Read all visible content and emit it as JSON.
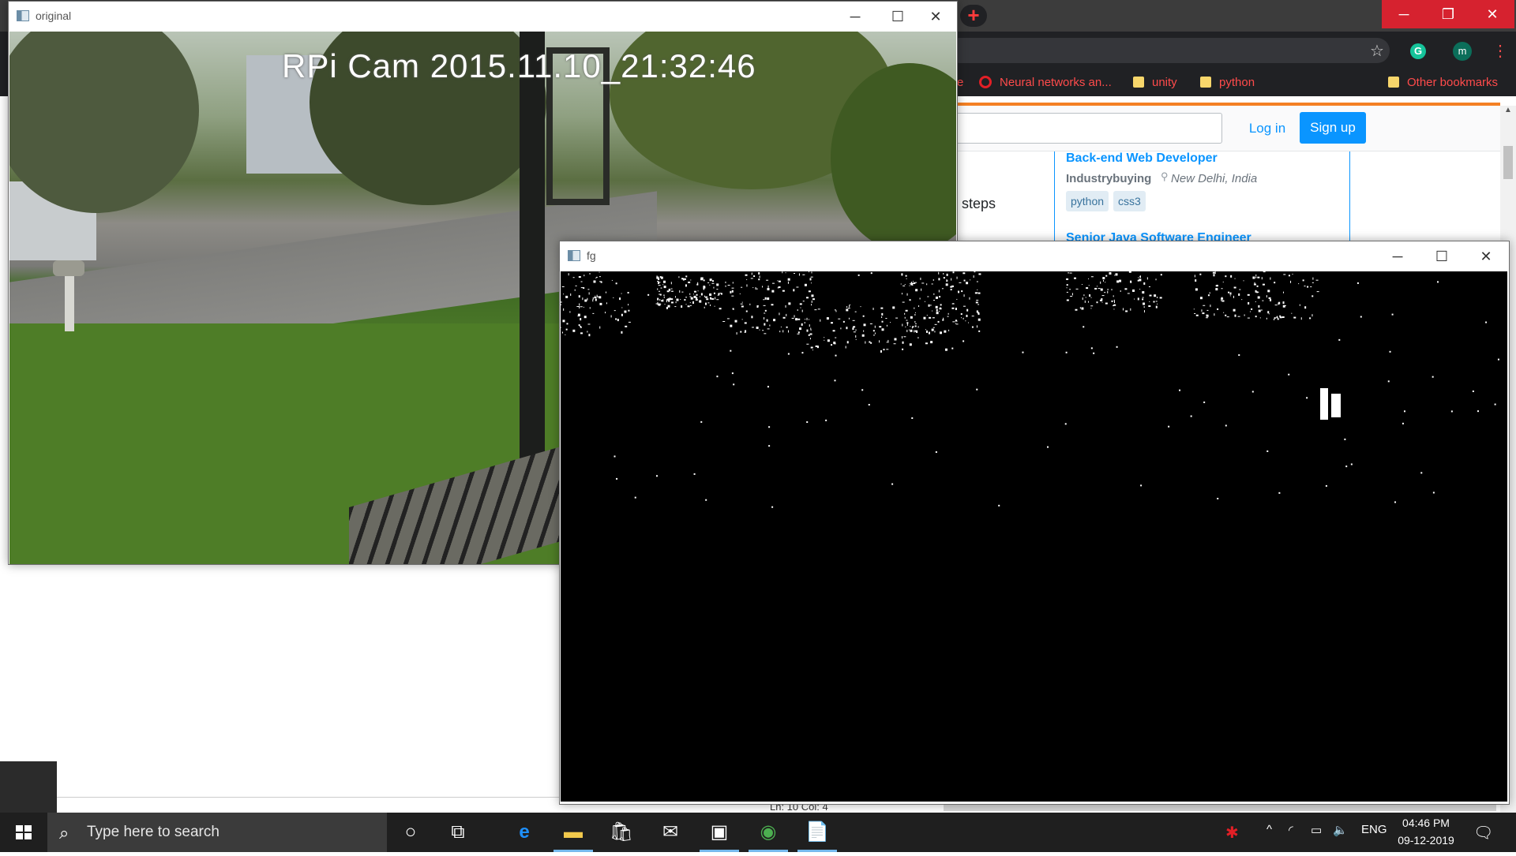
{
  "chrome": {
    "new_tab_label": "+",
    "profile_initial": "m",
    "bookmarks": [
      {
        "label": "e"
      },
      {
        "label": "Neural networks an..."
      },
      {
        "label": "unity"
      },
      {
        "label": "python"
      },
      {
        "label": "Other bookmarks"
      }
    ]
  },
  "stackoverflow": {
    "login_label": "Log in",
    "signup_label": "Sign up",
    "steps_text": "w steps",
    "job": {
      "title": "Back-end Web Developer",
      "company": "Industrybuying",
      "location": "New Delhi, India",
      "tags": [
        "python",
        "css3"
      ],
      "next_title": "Senior Java Software Engineer"
    }
  },
  "editor": {
    "status": "Ln: 10   Col: 4"
  },
  "windows": {
    "original": {
      "title": "original",
      "overlay": "RPi Cam 2015.11.10_21:32:46"
    },
    "fg": {
      "title": "fg"
    }
  },
  "taskbar": {
    "search_placeholder": "Type here to search",
    "language": "ENG",
    "time": "04:46 PM",
    "date": "09-12-2019",
    "icons": [
      "cortana-icon",
      "task-view-icon",
      "edge-icon",
      "file-explorer-icon",
      "store-icon",
      "mail-icon",
      "app-icon",
      "chrome-icon",
      "python-file-icon"
    ]
  }
}
